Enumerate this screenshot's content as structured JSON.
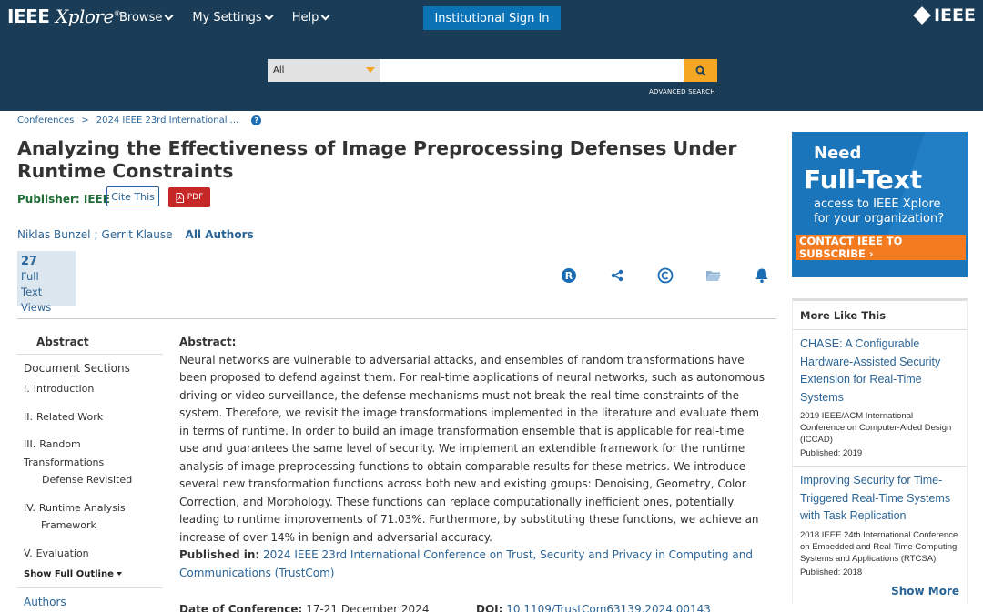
{
  "header": {
    "logo_main": "IEEE",
    "logo_xplore": "Xplore",
    "logo_reg": "®",
    "nav": [
      {
        "label": "Browse"
      },
      {
        "label": "My Settings"
      },
      {
        "label": "Help"
      }
    ],
    "signin_label": "Institutional Sign In",
    "brand": "IEEE",
    "search_scope": "All",
    "search_value": "",
    "advanced_search": "ADVANCED SEARCH"
  },
  "breadcrumb": {
    "items": [
      "Conferences",
      "2024 IEEE 23rd International ..."
    ],
    "separator": ">",
    "help": "?"
  },
  "article": {
    "title": "Analyzing the Effectiveness of Image Preprocessing Defenses Under Runtime Constraints",
    "publisher_label": "Publisher:",
    "publisher": "IEEE",
    "cite_label": "Cite This",
    "pdf_label": "PDF",
    "authors": [
      "Niklas Bunzel",
      "Gerrit Klause"
    ],
    "author_sep": ";",
    "all_authors": "All Authors",
    "views_count": "27",
    "views_line1": "Full",
    "views_line2": "Text Views"
  },
  "sidebar": {
    "abstract": "Abstract",
    "doc_sections": "Document Sections",
    "sections": [
      {
        "num": "I.",
        "label": "Introduction"
      },
      {
        "num": "II.",
        "label": "Related Work"
      },
      {
        "num": "III.",
        "label": "Random Transformations",
        "label2": "Defense Revisited"
      },
      {
        "num": "IV.",
        "label": "Runtime Analysis",
        "label2": "Framework"
      },
      {
        "num": "V.",
        "label": "Evaluation"
      }
    ],
    "show_outline": "Show Full Outline",
    "authors": "Authors"
  },
  "abstract": {
    "label": "Abstract:",
    "text": "Neural networks are vulnerable to adversarial attacks, and ensembles of random transformations have been proposed to defend against them. For real-time applications of neural networks, such as autonomous driving or video surveillance, the defense mechanisms must not break the real-time constraints of the system. Therefore, we revisit the image transformations implemented in the literature and evaluate them in terms of runtime. In order to build an image transformation ensemble that is applicable for real-time use and guarantees the same level of security. We implement an extendible framework for the runtime analysis of image preprocessing functions to obtain comparable results for these metrics. We introduce several new transformation functions across both new and existing groups: Denoising, Geometry, Color Correction, and Morphology. These functions can replace computationally inefficient ones, potentially leading to runtime improvements of 71.03%. Furthermore, by substituting these functions, we achieve an increase of over 14% in benign and adversarial accuracy.",
    "published_in_label": "Published in:",
    "published_in": "2024 IEEE 23rd International Conference on Trust, Security and Privacy in Computing and Communications (TrustCom)",
    "date_label": "Date of Conference:",
    "date": "17-21 December 2024",
    "doi_label": "DOI:",
    "doi": "10.1109/TrustCom63139.2024.00143"
  },
  "ad": {
    "need": "Need",
    "full_text": "Full-Text",
    "access_line1": "access to IEEE Xplore",
    "access_line2": "for your organization?",
    "contact": "CONTACT IEEE TO SUBSCRIBE ›"
  },
  "more_like_this": {
    "heading": "More Like This",
    "items": [
      {
        "title": "CHASE: A Configurable Hardware-Assisted Security Extension for Real-Time Systems",
        "conf": "2019 IEEE/ACM International Conference on Computer-Aided Design (ICCAD)",
        "published": "Published: 2019"
      },
      {
        "title": "Improving Security for Time-Triggered Real-Time Systems with Task Replication",
        "conf": "2018 IEEE 24th International Conference on Embedded and Real-Time Computing Systems and Applications (RTCSA)",
        "published": "Published: 2018"
      }
    ],
    "show_more": "Show More"
  },
  "colors": {
    "header_bg": "#1b3c56",
    "signin_bg": "#0a72b5",
    "search_btn": "#f5a623",
    "link": "#2a6496",
    "publisher_green": "#1e6b35",
    "pdf_red": "#c62828",
    "ad_blue": "#1b75bb",
    "ad_orange": "#f47b20"
  }
}
